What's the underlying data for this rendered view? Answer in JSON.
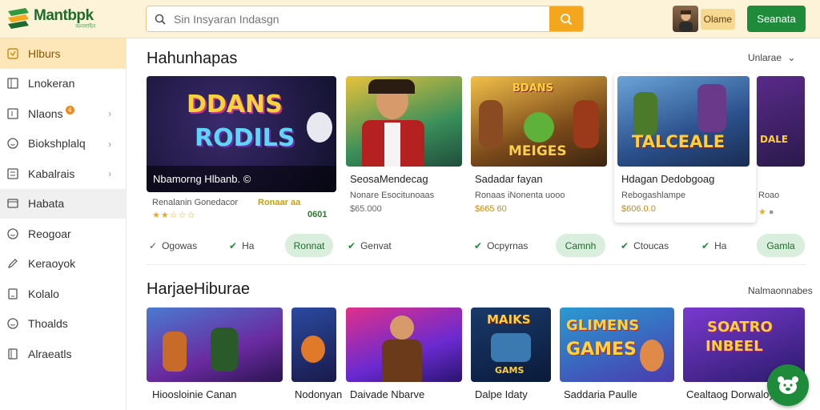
{
  "header": {
    "logo_title": "Mantbpk",
    "logo_subtitle": "অনলাইন",
    "search_placeholder": "Sin Insyaran Indasgn",
    "user_name": "Olame",
    "signup_label": "Seanata"
  },
  "sidebar": {
    "items": [
      {
        "label": "Hlburs",
        "icon": "bookmark-icon"
      },
      {
        "label": "Lnokeran",
        "icon": "grid-icon"
      },
      {
        "label": "Nlaons",
        "icon": "board-icon",
        "badge": "4"
      },
      {
        "label": "Biokshplalq",
        "icon": "smile-icon"
      },
      {
        "label": "Kabalrais",
        "icon": "menu-icon"
      },
      {
        "label": "Habata",
        "icon": "folder-icon"
      },
      {
        "label": "Reogoar",
        "icon": "smile-icon"
      },
      {
        "label": "Keraoyok",
        "icon": "pencil-icon"
      },
      {
        "label": "Kolalo",
        "icon": "list-icon"
      },
      {
        "label": "Thoalds",
        "icon": "smile-icon"
      },
      {
        "label": "Alraeatls",
        "icon": "book-icon"
      }
    ]
  },
  "section1": {
    "title": "Hahunhapas",
    "link": "Unlarae",
    "cards": [
      {
        "thumb_text": "DDANS RODILS",
        "title": "Nbamorng Hlbanb. ©",
        "sub": "Renalanin Gonedacor",
        "sub2": "Ronaar aa",
        "meta": "0601",
        "stars": "★★☆☆☆"
      },
      {
        "thumb_text": "",
        "title": "SeosaMendecag",
        "sub": "Nonare Esocitunoaas",
        "meta": "$65.000"
      },
      {
        "thumb_text": "MEIGES",
        "title": "Sadadar fayan",
        "sub": "Ronaas iNonenta uooo",
        "meta": "$665 60"
      },
      {
        "thumb_text": "TALCEALE",
        "title": "Hdagan Dedobgoag",
        "sub": "Rebogashlampe",
        "meta": "$606.0.0"
      },
      {
        "thumb_text": "DALE",
        "title": "",
        "sub": "Roao",
        "meta": ""
      }
    ],
    "actions": [
      {
        "label": "Ogowas",
        "pill": "Ronnat"
      },
      {
        "label": "Ha",
        "pill": ""
      },
      {
        "label": "Genvat",
        "pill": ""
      },
      {
        "label": "Ocpyrnas",
        "pill": "Camnh"
      },
      {
        "label": "Ctoucas",
        "pill": ""
      },
      {
        "label": "Ha",
        "pill": "Gamla"
      }
    ]
  },
  "section2": {
    "title": "HarjaeHiburae",
    "link": "Nalmaonnabes",
    "cards": [
      {
        "thumb_text": "",
        "title": "Hioosloinie Canan"
      },
      {
        "thumb_text": "",
        "title": "Nodonyan"
      },
      {
        "thumb_text": "",
        "title": "Daivade Nbarve"
      },
      {
        "thumb_text": "MAIKS GAMS",
        "title": "Dalpe Idaty"
      },
      {
        "thumb_text": "GLIMENS GAMES",
        "title": "Saddaria Paulle"
      },
      {
        "thumb_text": "SOATRO INBEEL",
        "title": "Cealtaog Dorwaloye"
      }
    ]
  },
  "colors": {
    "header_bg": "#fdf3d8",
    "accent_orange": "#f4a61c",
    "brand_green": "#1e8b3a",
    "sidebar_active": "#fde7b8"
  }
}
